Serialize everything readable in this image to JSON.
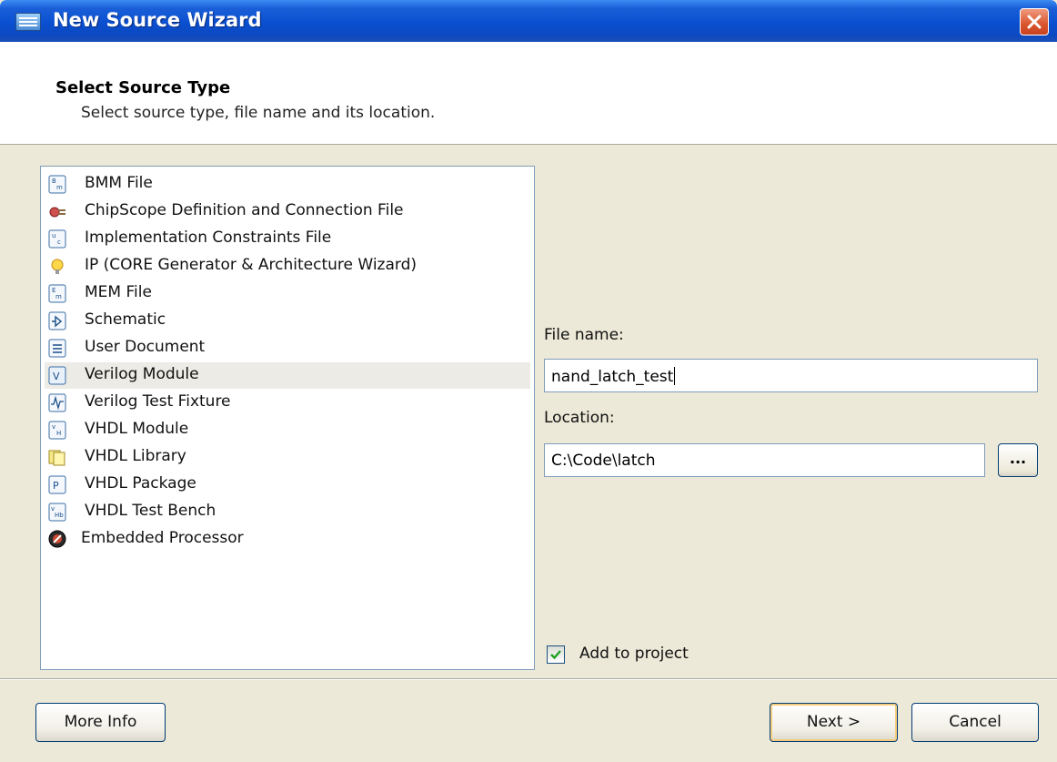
{
  "window": {
    "title": "New Source Wizard"
  },
  "header": {
    "title": "Select Source Type",
    "subtitle": "Select source type, file name and its location."
  },
  "source_types": [
    {
      "label": "BMM File",
      "icon": "bmm-file-icon",
      "selected": false
    },
    {
      "label": "ChipScope Definition and Connection File",
      "icon": "chipscope-icon",
      "selected": false
    },
    {
      "label": "Implementation Constraints File",
      "icon": "constraints-file-icon",
      "selected": false
    },
    {
      "label": "IP (CORE Generator & Architecture Wizard)",
      "icon": "ip-wizard-icon",
      "selected": false
    },
    {
      "label": "MEM File",
      "icon": "mem-file-icon",
      "selected": false
    },
    {
      "label": "Schematic",
      "icon": "schematic-icon",
      "selected": false
    },
    {
      "label": "User Document",
      "icon": "user-document-icon",
      "selected": false
    },
    {
      "label": "Verilog Module",
      "icon": "verilog-module-icon",
      "selected": true
    },
    {
      "label": "Verilog Test Fixture",
      "icon": "verilog-test-fixture-icon",
      "selected": false
    },
    {
      "label": "VHDL Module",
      "icon": "vhdl-module-icon",
      "selected": false
    },
    {
      "label": "VHDL Library",
      "icon": "vhdl-library-icon",
      "selected": false
    },
    {
      "label": "VHDL Package",
      "icon": "vhdl-package-icon",
      "selected": false
    },
    {
      "label": "VHDL Test Bench",
      "icon": "vhdl-test-bench-icon",
      "selected": false
    },
    {
      "label": "Embedded Processor",
      "icon": "embedded-processor-icon",
      "selected": false
    }
  ],
  "form": {
    "file_name_label": "File name:",
    "file_name_value": "nand_latch_test",
    "location_label": "Location:",
    "location_value": "C:\\Code\\latch",
    "browse_label": "...",
    "add_to_project_label": "Add to project",
    "add_to_project_checked": true
  },
  "buttons": {
    "more_info": "More Info",
    "next": "Next >",
    "cancel": "Cancel"
  },
  "colors": {
    "title_bar": "#0a4fd0",
    "dialog_bg": "#ece9d8",
    "selection_bg": "#ecebe5",
    "default_button_highlight": "#f5cc7d"
  }
}
